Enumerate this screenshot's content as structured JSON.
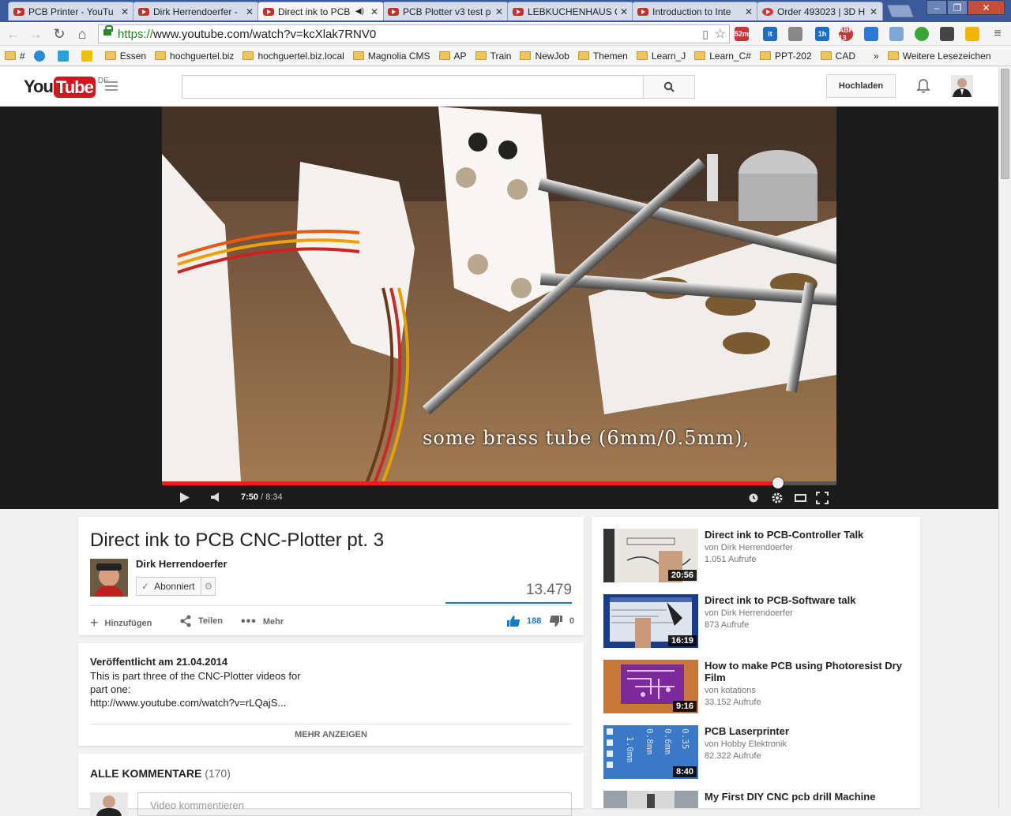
{
  "browser": {
    "tabs": [
      {
        "title": "PCB Printer - YouTu",
        "active": false
      },
      {
        "title": "Dirk Herrendoerfer -",
        "active": false
      },
      {
        "title": "Direct ink to PCB",
        "active": true
      },
      {
        "title": "PCB Plotter v3 test p",
        "active": false
      },
      {
        "title": "LEBKUCHENHAUS C",
        "active": false
      },
      {
        "title": "Introduction to Inte",
        "active": false
      },
      {
        "title": "Order 493023 | 3D H",
        "active": false
      }
    ],
    "url_scheme": "https://",
    "url_rest": "www.youtube.com/watch?v=kcXlak7RNV0",
    "extensions": [
      {
        "name": "52m",
        "color": "#c33"
      },
      {
        "name": "it",
        "color": "#1a6fc4"
      },
      {
        "name": "1h",
        "color": "#1a6fc4"
      },
      {
        "name": "ABP 13",
        "color": "#c33"
      }
    ],
    "bookmarks": [
      "#",
      "",
      "",
      "",
      "Essen",
      "hochguertel.biz",
      "hochguertel.biz.local",
      "Magnolia CMS",
      "AP",
      "Train",
      "NewJob",
      "Themen",
      "Learn_J",
      "Learn_C#",
      "PPT-202",
      "CAD"
    ],
    "bookmarks_more": "»",
    "other_bookmarks": "Weitere Lesezeichen"
  },
  "youtube": {
    "logo_you": "You",
    "logo_tube": "Tube",
    "region": "DE",
    "upload_label": "Hochladen",
    "search_placeholder": ""
  },
  "player": {
    "subtitle": "some brass tube (6mm/0.5mm),",
    "current_time": "7:50",
    "duration": "/ 8:34",
    "progress": 0.913
  },
  "video": {
    "title": "Direct ink to PCB CNC-Plotter pt. 3",
    "channel": "Dirk Herrendoerfer",
    "subscribe_label": "Abonniert",
    "views": "13.479",
    "like_ratio": 1.0,
    "add_label": "Hinzufügen",
    "share_label": "Teilen",
    "more_label": "Mehr",
    "likes": "188",
    "dislikes": "0"
  },
  "description": {
    "published": "Veröffentlicht am 21.04.2014",
    "lines": [
      "This is part three of the CNC-Plotter videos for",
      "part one:",
      "http://www.youtube.com/watch?v=rLQajS..."
    ],
    "show_more": "MEHR ANZEIGEN"
  },
  "comments": {
    "heading": "ALLE KOMMENTARE",
    "count": "(170)",
    "input_placeholder": "Video kommentieren"
  },
  "related": [
    {
      "title": "Direct ink to PCB-Controller Talk",
      "channel": "von Dirk Herrendoerfer",
      "views": "1.051 Aufrufe",
      "duration": "20:56",
      "thumb": "whiteboard"
    },
    {
      "title": "Direct ink to PCB-Software talk",
      "channel": "von Dirk Herrendoerfer",
      "views": "873 Aufrufe",
      "duration": "16:19",
      "thumb": "screen"
    },
    {
      "title": "How to make PCB using Photoresist Dry Film",
      "channel": "von kotations",
      "views": "33.152 Aufrufe",
      "duration": "9:16",
      "thumb": "purple-pcb"
    },
    {
      "title": "PCB Laserprinter",
      "channel": "von Hobby Elektronik",
      "views": "82.322 Aufrufe",
      "duration": "8:40",
      "thumb": "blue-board"
    },
    {
      "title": "My First DIY CNC pcb drill Machine",
      "channel": "",
      "views": "",
      "duration": "",
      "thumb": "cnc"
    }
  ]
}
